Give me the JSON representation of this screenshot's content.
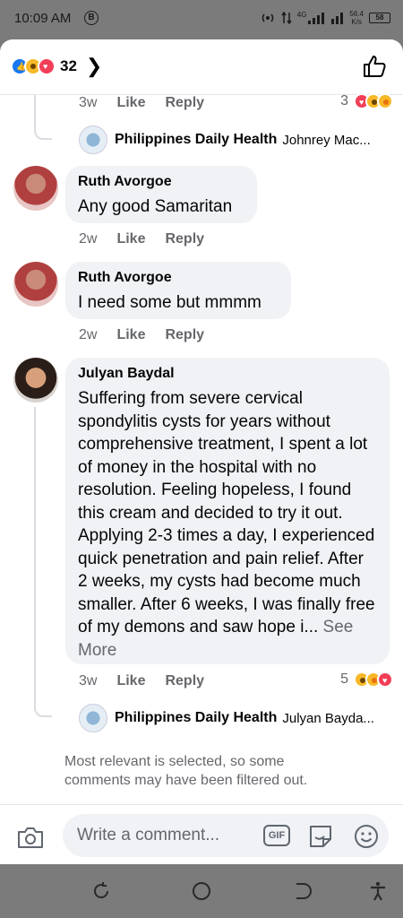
{
  "status": {
    "time": "10:09 AM",
    "b_badge": "B",
    "network": "4G",
    "speed_value": "56.4",
    "speed_unit": "K/s",
    "battery": "58"
  },
  "header": {
    "reaction_count": "32",
    "reaction_icons": [
      "like-icon",
      "wow-icon",
      "love-icon"
    ]
  },
  "top_comment_actions": {
    "age": "3w",
    "like": "Like",
    "reply": "Reply",
    "reaction_count": "3"
  },
  "top_reply": {
    "name": "Philippines Daily Health",
    "text": "Johnrey Mac..."
  },
  "comments": [
    {
      "name": "Ruth Avorgoe",
      "text": "Any good Samaritan",
      "age": "2w",
      "like": "Like",
      "reply": "Reply"
    },
    {
      "name": "Ruth Avorgoe",
      "text": "I need some but mmmm",
      "age": "2w",
      "like": "Like",
      "reply": "Reply"
    },
    {
      "name": "Julyan Baydal",
      "text": "Suffering from severe cervical spondylitis cysts for years without comprehensive treatment, I spent a lot of money in the hospital with no resolution. Feeling hopeless, I found this cream and decided to try it out. Applying 2-3 times a day, I experienced quick penetration and pain relief. After 2 weeks, my cysts had become much smaller. After 6 weeks, I was finally free of my demons and saw hope i...",
      "see_more": "See More",
      "age": "3w",
      "like": "Like",
      "reply": "Reply",
      "reaction_count": "5"
    }
  ],
  "bottom_reply": {
    "name": "Philippines Daily Health",
    "text": "Julyan Bayda..."
  },
  "note": "Most relevant is selected, so some comments may have been filtered out.",
  "composer": {
    "placeholder": "Write a comment...",
    "gif_label": "GIF"
  },
  "colors": {
    "like_blue": "#1877f2",
    "love_red": "#f33e58",
    "wow_yellow": "#f7b928",
    "muted_text": "#65676b",
    "bubble_bg": "#f0f2f5"
  }
}
